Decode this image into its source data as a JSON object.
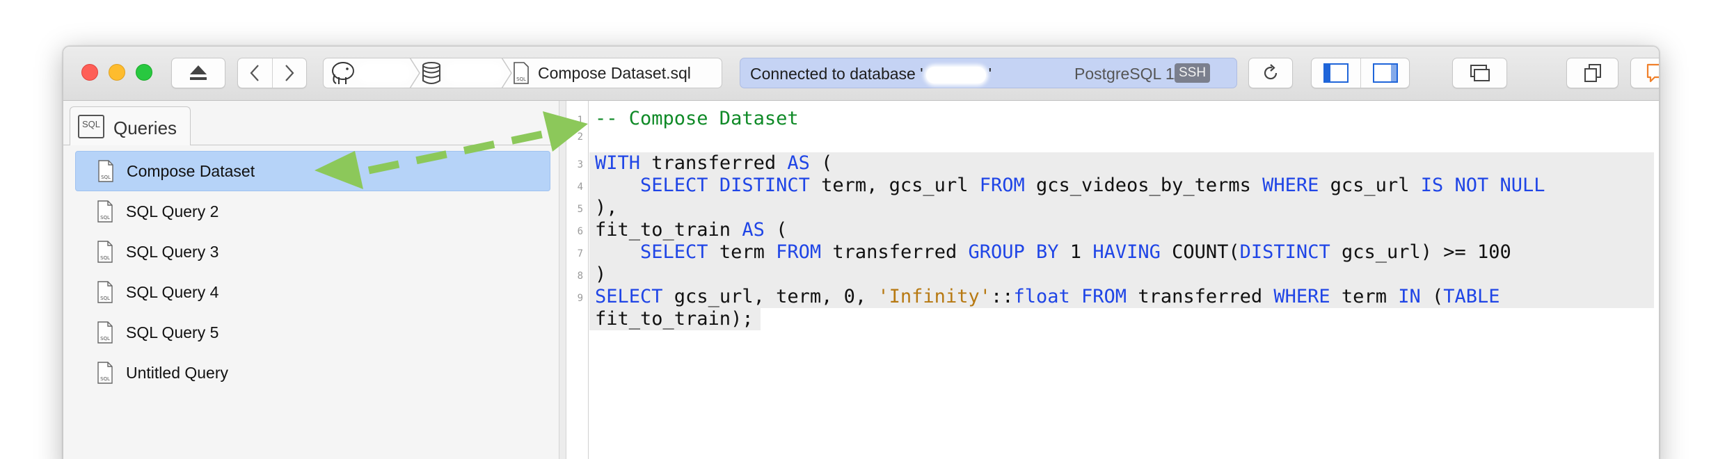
{
  "toolbar": {
    "path_file_label": "Compose Dataset.sql",
    "status_prefix": "Connected to database '",
    "status_suffix": "'",
    "server_version": "PostgreSQL 11.9",
    "ssh_badge": "SSH"
  },
  "sidebar": {
    "tab_label": "Queries",
    "tab_icon_text": "SQL",
    "items": [
      {
        "label": "Compose Dataset"
      },
      {
        "label": "SQL Query 2"
      },
      {
        "label": "SQL Query 3"
      },
      {
        "label": "SQL Query 4"
      },
      {
        "label": "SQL Query 5"
      },
      {
        "label": "Untitled Query"
      }
    ]
  },
  "editor": {
    "line_numbers": [
      "1",
      "2",
      "3",
      "4",
      "5",
      "6",
      "7",
      "8",
      "9"
    ],
    "lines": [
      [
        {
          "t": "-- Compose Dataset",
          "c": "cm"
        }
      ],
      [],
      [
        {
          "t": "WITH",
          "c": "kw"
        },
        {
          "t": " transferred ",
          "c": ""
        },
        {
          "t": "AS",
          "c": "kw"
        },
        {
          "t": " (",
          "c": ""
        }
      ],
      [
        {
          "t": "    ",
          "c": ""
        },
        {
          "t": "SELECT DISTINCT",
          "c": "kw"
        },
        {
          "t": " term, gcs_url ",
          "c": ""
        },
        {
          "t": "FROM",
          "c": "kw"
        },
        {
          "t": " gcs_videos_by_terms ",
          "c": ""
        },
        {
          "t": "WHERE",
          "c": "kw"
        },
        {
          "t": " gcs_url ",
          "c": ""
        },
        {
          "t": "IS NOT NULL",
          "c": "kw"
        }
      ],
      [
        {
          "t": "),",
          "c": ""
        }
      ],
      [
        {
          "t": "fit_to_train ",
          "c": ""
        },
        {
          "t": "AS",
          "c": "kw"
        },
        {
          "t": " (",
          "c": ""
        }
      ],
      [
        {
          "t": "    ",
          "c": ""
        },
        {
          "t": "SELECT",
          "c": "kw"
        },
        {
          "t": " term ",
          "c": ""
        },
        {
          "t": "FROM",
          "c": "kw"
        },
        {
          "t": " transferred ",
          "c": ""
        },
        {
          "t": "GROUP BY",
          "c": "kw"
        },
        {
          "t": " 1 ",
          "c": ""
        },
        {
          "t": "HAVING",
          "c": "kw"
        },
        {
          "t": " COUNT(",
          "c": ""
        },
        {
          "t": "DISTINCT",
          "c": "kw"
        },
        {
          "t": " gcs_url) >= 100",
          "c": ""
        }
      ],
      [
        {
          "t": ")",
          "c": ""
        }
      ],
      [
        {
          "t": "SELECT",
          "c": "kw"
        },
        {
          "t": " gcs_url, term, 0, ",
          "c": ""
        },
        {
          "t": "'Infinity'",
          "c": "str"
        },
        {
          "t": "::",
          "c": ""
        },
        {
          "t": "float",
          "c": "kw"
        },
        {
          "t": " ",
          "c": ""
        },
        {
          "t": "FROM",
          "c": "kw"
        },
        {
          "t": " transferred ",
          "c": ""
        },
        {
          "t": "WHERE",
          "c": "kw"
        },
        {
          "t": " term ",
          "c": ""
        },
        {
          "t": "IN",
          "c": "kw"
        },
        {
          "t": " (",
          "c": ""
        },
        {
          "t": "TABLE",
          "c": "kw"
        }
      ],
      [
        {
          "t": "fit_to_train);",
          "c": ""
        }
      ]
    ]
  },
  "colors": {
    "selection": "#b6d3f8",
    "status_bar": "#c5d3f4",
    "keyword": "#1f45e6",
    "comment": "#0f8a27",
    "string": "#b77912",
    "annotation_arrow": "#8cc85a"
  }
}
